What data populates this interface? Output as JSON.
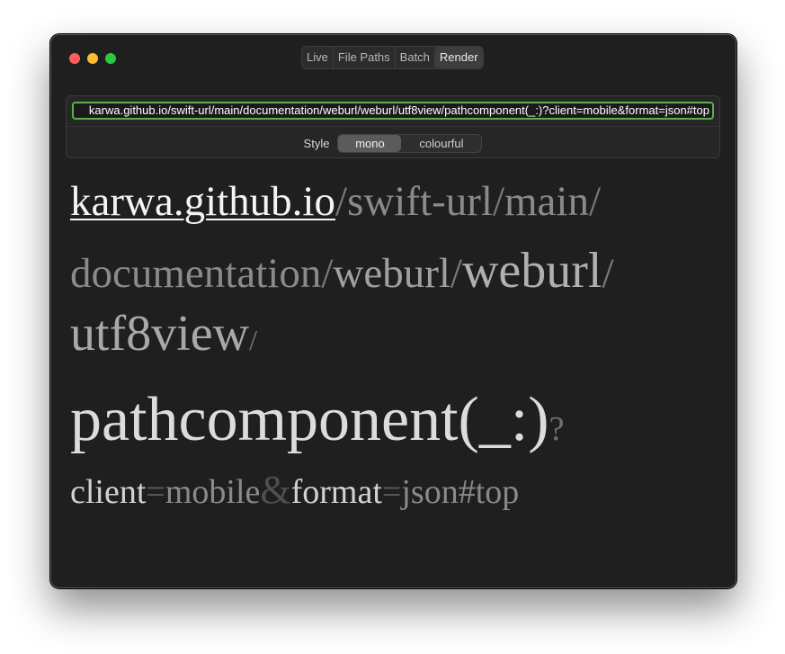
{
  "window": {
    "tabs": [
      "Live",
      "File Paths",
      "Batch",
      "Render"
    ],
    "active_tab": "Render"
  },
  "url_field": {
    "value": "karwa.github.io/swift-url/main/documentation/weburl/weburl/utf8view/pathcomponent(_:)?client=mobile&format=json#top"
  },
  "style": {
    "label": "Style",
    "options": [
      "mono",
      "colourful"
    ],
    "selected": "mono"
  },
  "render": {
    "host": "karwa.github.io",
    "segments": [
      "swift-url",
      "main",
      "documentation",
      "weburl",
      "weburl",
      "utf8view",
      "pathcomponent(_:)"
    ],
    "separator": "/",
    "query_mark": "?",
    "query": [
      {
        "key": "client",
        "value": "mobile"
      },
      {
        "key": "format",
        "value": "json"
      }
    ],
    "eq": "=",
    "amp": "&",
    "fragment": "#top"
  },
  "colors": {
    "window_bg": "#1f1f1f",
    "url_border": "#5fae4f",
    "close": "#ff5f57",
    "minimize": "#febc2e",
    "maximize": "#28c840"
  }
}
